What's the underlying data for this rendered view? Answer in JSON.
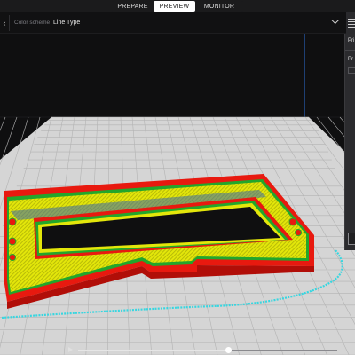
{
  "tabs": [
    {
      "label": "PREPARE",
      "active": false
    },
    {
      "label": "PREVIEW",
      "active": true
    },
    {
      "label": "MONITOR",
      "active": false
    }
  ],
  "toolbar": {
    "color_scheme_label": "Color scheme",
    "color_scheme_value": "Line Type"
  },
  "side_panel": {
    "title_partial": "Pri",
    "sub_partial": "Pr"
  },
  "scrubber": {
    "progress": 0.58
  },
  "colors": {
    "wall_outer": "#e8190f",
    "wall_inner": "#23a62b",
    "infill": "#e3e60a",
    "support_blue": "#3c6ba8",
    "travel_cyan": "#38d6e0",
    "build_plate": "#d5d5d5",
    "grid_line": "#b0b0b0",
    "background": "#0f0f10"
  },
  "icons": {
    "settings": "settings-sliders-icon",
    "collapse": "chevron-left-icon",
    "play": "play-icon"
  }
}
